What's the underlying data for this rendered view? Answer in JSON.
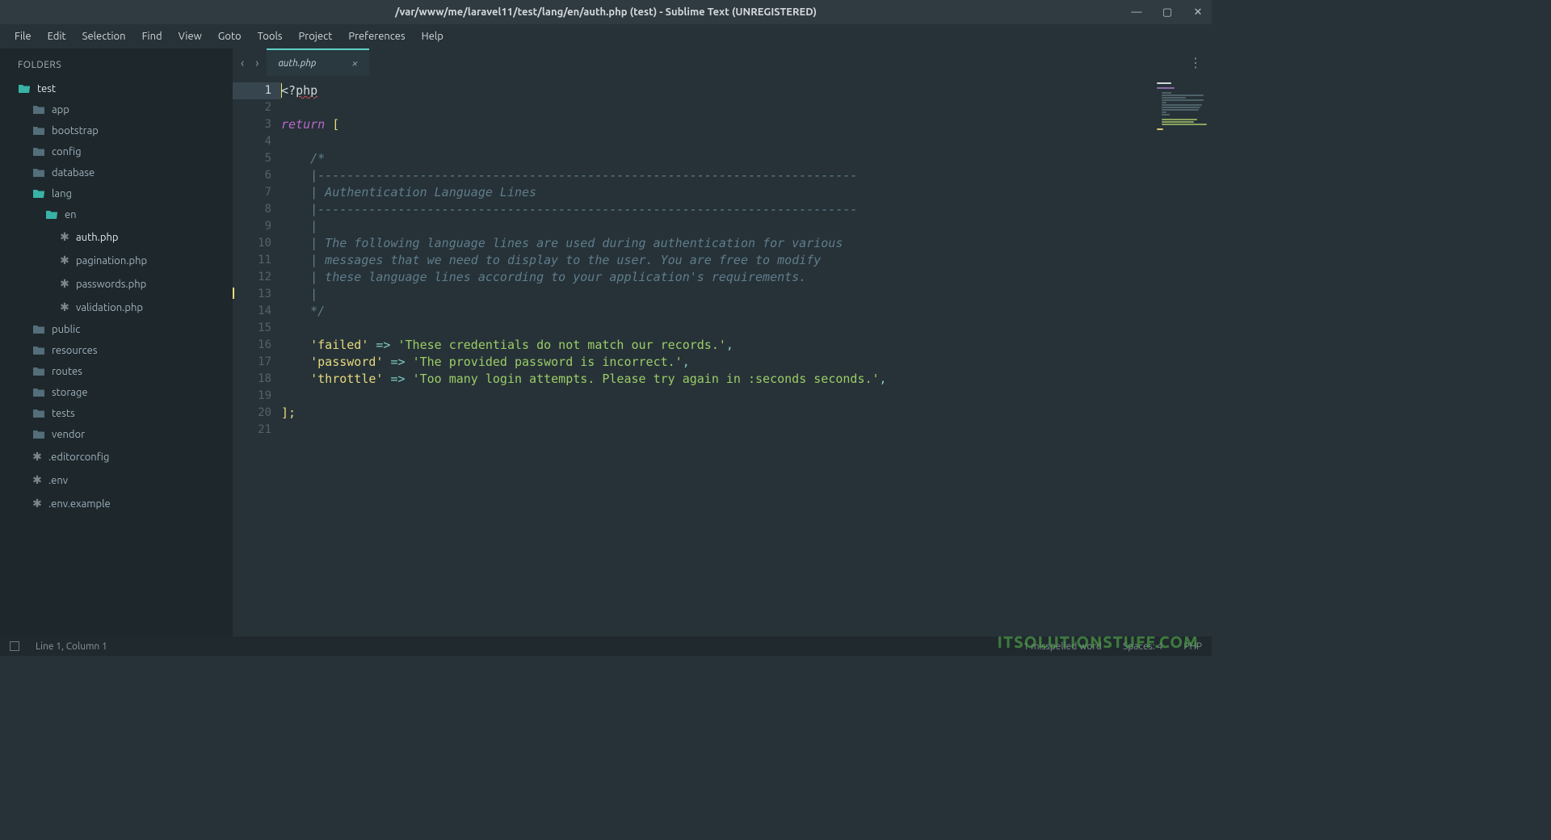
{
  "window": {
    "title": "/var/www/me/laravel11/test/lang/en/auth.php (test) - Sublime Text (UNREGISTERED)"
  },
  "menu": [
    "File",
    "Edit",
    "Selection",
    "Find",
    "View",
    "Goto",
    "Tools",
    "Project",
    "Preferences",
    "Help"
  ],
  "sidebar": {
    "header": "FOLDERS",
    "items": [
      {
        "label": "test",
        "type": "folder-open",
        "indent": 1,
        "highlight": true
      },
      {
        "label": "app",
        "type": "folder",
        "indent": 2
      },
      {
        "label": "bootstrap",
        "type": "folder",
        "indent": 2
      },
      {
        "label": "config",
        "type": "folder",
        "indent": 2
      },
      {
        "label": "database",
        "type": "folder",
        "indent": 2
      },
      {
        "label": "lang",
        "type": "folder-open",
        "indent": 2
      },
      {
        "label": "en",
        "type": "folder-open",
        "indent": 3
      },
      {
        "label": "auth.php",
        "type": "file",
        "indent": 4,
        "active": true
      },
      {
        "label": "pagination.php",
        "type": "file",
        "indent": 4
      },
      {
        "label": "passwords.php",
        "type": "file",
        "indent": 4
      },
      {
        "label": "validation.php",
        "type": "file",
        "indent": 4
      },
      {
        "label": "public",
        "type": "folder",
        "indent": 2
      },
      {
        "label": "resources",
        "type": "folder",
        "indent": 2
      },
      {
        "label": "routes",
        "type": "folder",
        "indent": 2
      },
      {
        "label": "storage",
        "type": "folder",
        "indent": 2
      },
      {
        "label": "tests",
        "type": "folder",
        "indent": 2
      },
      {
        "label": "vendor",
        "type": "folder",
        "indent": 2
      },
      {
        "label": ".editorconfig",
        "type": "file",
        "indent": 2
      },
      {
        "label": ".env",
        "type": "file",
        "indent": 2
      },
      {
        "label": ".env.example",
        "type": "file",
        "indent": 2
      }
    ]
  },
  "tabs": [
    {
      "label": "auth.php"
    }
  ],
  "code": {
    "php_open": "<?php",
    "return_kw": "return",
    "open_bracket": "[",
    "c1": "/*",
    "c2": "|--------------------------------------------------------------------------",
    "c3": "| Authentication Language Lines",
    "c4": "|--------------------------------------------------------------------------",
    "c5": "|",
    "c6": "| The following language lines are used during authentication for various",
    "c7": "| messages that we need to display to the user. You are free to modify",
    "c8": "| these language lines according to your application's requirements.",
    "c9": "|",
    "c10": "*/",
    "k_failed": "'failed'",
    "v_failed": "'These credentials do not match our records.'",
    "k_password": "'password'",
    "v_password": "'The provided password is incorrect.'",
    "k_throttle": "'throttle'",
    "v_throttle": "'Too many login attempts. Please try again in :seconds seconds.'",
    "arrow": "=>",
    "comma": ",",
    "close": "];"
  },
  "status": {
    "pos": "Line 1, Column 1",
    "spell": "1 misspelled word",
    "spaces": "Spaces: 4",
    "lang": "PHP"
  },
  "watermark": "ITSOLUTIONSTUFF.COM",
  "icons": {
    "minimize": "—",
    "maximize": "▢",
    "close": "✕",
    "kebab": "⋮",
    "tab_close": "×",
    "chev_left": "‹",
    "chev_right": "›",
    "file_glyph": "✱"
  }
}
